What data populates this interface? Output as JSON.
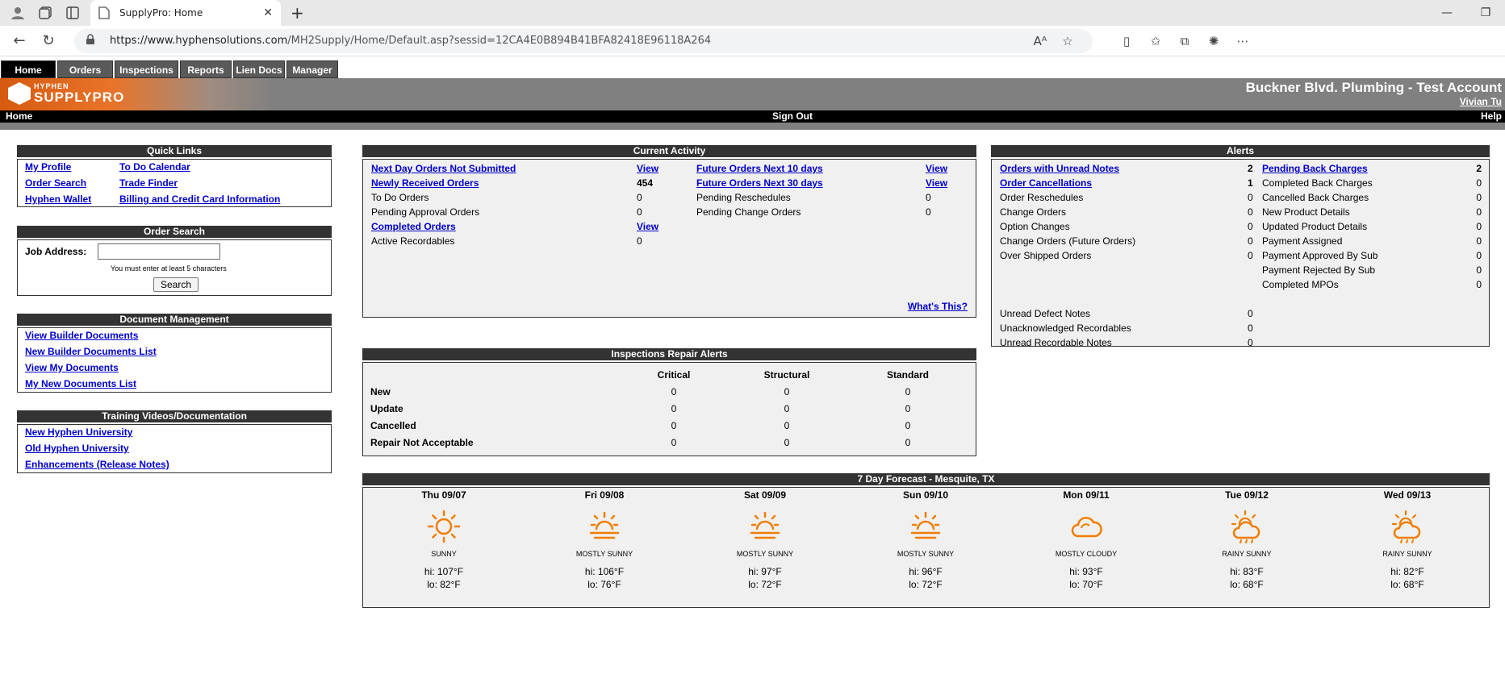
{
  "browser": {
    "tab_title": "SupplyPro: Home",
    "url_host": "https://www.hyphensolutions.com",
    "url_path": "/MH2Supply/Home/Default.asp?sessid=12CA4E0B894B41BFA82418E96118A264"
  },
  "site_nav": {
    "items": [
      "Home",
      "Orders",
      "Inspections",
      "Reports",
      "Lien Docs",
      "Manager"
    ],
    "active": "Home"
  },
  "brand": {
    "logo_top": "HYPHEN",
    "logo_bottom": "SUPPLYPRO"
  },
  "account": {
    "name": "Buckner Blvd. Plumbing - Test Account",
    "user": "Vivian Tu"
  },
  "bar": {
    "left": "Home",
    "center": "Sign Out",
    "right": "Help"
  },
  "quick_links": {
    "title": "Quick Links",
    "col1": [
      "My Profile",
      "Order Search",
      "Hyphen Wallet"
    ],
    "col2": [
      "To Do Calendar",
      "Trade Finder",
      "Billing and Credit Card Information"
    ]
  },
  "order_search": {
    "title": "Order Search",
    "label": "Job Address:",
    "value": "",
    "hint": "You must enter at least 5 characters",
    "button": "Search"
  },
  "doc_mgmt": {
    "title": "Document Management",
    "links": [
      "View Builder Documents",
      "New Builder Documents List",
      "View My Documents",
      "My New Documents List"
    ]
  },
  "training": {
    "title": "Training Videos/Documentation",
    "links": [
      "New Hyphen University",
      "Old Hyphen University",
      "Enhancements (Release Notes)"
    ]
  },
  "current_activity": {
    "title": "Current Activity",
    "left": [
      {
        "label": "Next Day Orders Not Submitted",
        "value": "View",
        "link": true,
        "vlink": true
      },
      {
        "label": "Newly Received Orders",
        "value": "454",
        "link": true,
        "vlink": false
      },
      {
        "label": "To Do Orders",
        "value": "0",
        "link": false,
        "vlink": false
      },
      {
        "label": "Pending Approval Orders",
        "value": "0",
        "link": false,
        "vlink": false
      },
      {
        "label": "Completed Orders",
        "value": "View",
        "link": true,
        "vlink": true
      },
      {
        "label": "Active Recordables",
        "value": "0",
        "link": false,
        "vlink": false
      }
    ],
    "right": [
      {
        "label": "Future Orders Next 10 days",
        "value": "View",
        "link": true,
        "vlink": true
      },
      {
        "label": "Future Orders Next 30 days",
        "value": "View",
        "link": true,
        "vlink": true
      },
      {
        "label": "Pending Reschedules",
        "value": "0",
        "link": false,
        "vlink": false
      },
      {
        "label": "Pending Change Orders",
        "value": "0",
        "link": false,
        "vlink": false
      }
    ],
    "whats_this": "What's This?"
  },
  "alerts": {
    "title": "Alerts",
    "left": [
      {
        "label": "Orders with Unread Notes",
        "value": "2",
        "link": true
      },
      {
        "label": "Order Cancellations",
        "value": "1",
        "link": true
      },
      {
        "label": "Order Reschedules",
        "value": "0",
        "link": false
      },
      {
        "label": "Change Orders",
        "value": "0",
        "link": false
      },
      {
        "label": "Option Changes",
        "value": "0",
        "link": false
      },
      {
        "label": "Change Orders (Future Orders)",
        "value": "0",
        "link": false
      },
      {
        "label": "Over Shipped Orders",
        "value": "0",
        "link": false
      }
    ],
    "right": [
      {
        "label": "Pending Back Charges",
        "value": "2",
        "link": true
      },
      {
        "label": "Completed Back Charges",
        "value": "0",
        "link": false
      },
      {
        "label": "Cancelled Back Charges",
        "value": "0",
        "link": false
      },
      {
        "label": "New Product Details",
        "value": "0",
        "link": false
      },
      {
        "label": "Updated Product Details",
        "value": "0",
        "link": false
      },
      {
        "label": "Payment Assigned",
        "value": "0",
        "link": false
      },
      {
        "label": "Payment Approved By Sub",
        "value": "0",
        "link": false
      },
      {
        "label": "Payment Rejected By Sub",
        "value": "0",
        "link": false
      },
      {
        "label": "Completed MPOs",
        "value": "0",
        "link": false
      }
    ],
    "bottom": [
      {
        "label": "Unread Defect Notes",
        "value": "0"
      },
      {
        "label": "Unacknowledged Recordables",
        "value": "0"
      },
      {
        "label": "Unread Recordable Notes",
        "value": "0"
      }
    ]
  },
  "inspections": {
    "title": "Inspections Repair Alerts",
    "columns": [
      "Critical",
      "Structural",
      "Standard"
    ],
    "rows": [
      {
        "label": "New",
        "values": [
          "0",
          "0",
          "0"
        ]
      },
      {
        "label": "Update",
        "values": [
          "0",
          "0",
          "0"
        ]
      },
      {
        "label": "Cancelled",
        "values": [
          "0",
          "0",
          "0"
        ]
      },
      {
        "label": "Repair Not Acceptable",
        "values": [
          "0",
          "0",
          "0"
        ]
      }
    ]
  },
  "forecast": {
    "title": "7 Day Forecast  -  Mesquite, TX",
    "days": [
      {
        "day": "Thu 09/07",
        "icon": "sun-icon",
        "cond": "SUNNY",
        "hi": "hi: 107°F",
        "lo": "lo: 82°F"
      },
      {
        "day": "Fri 09/08",
        "icon": "sunrise-icon",
        "cond": "MOSTLY SUNNY",
        "hi": "hi: 106°F",
        "lo": "lo: 76°F"
      },
      {
        "day": "Sat 09/09",
        "icon": "sunrise-icon",
        "cond": "MOSTLY SUNNY",
        "hi": "hi: 97°F",
        "lo": "lo: 72°F"
      },
      {
        "day": "Sun 09/10",
        "icon": "sunrise-icon",
        "cond": "MOSTLY SUNNY",
        "hi": "hi: 96°F",
        "lo": "lo: 72°F"
      },
      {
        "day": "Mon 09/11",
        "icon": "cloud-icon",
        "cond": "MOSTLY CLOUDY",
        "hi": "hi: 93°F",
        "lo": "lo: 70°F"
      },
      {
        "day": "Tue 09/12",
        "icon": "sun-cloud-icon",
        "cond": "RAINY SUNNY",
        "hi": "hi: 83°F",
        "lo": "lo: 68°F"
      },
      {
        "day": "Wed 09/13",
        "icon": "sun-cloud-icon",
        "cond": "RAINY SUNNY",
        "hi": "hi: 82°F",
        "lo": "lo: 68°F"
      }
    ],
    "icon_color": "#f07d00"
  }
}
